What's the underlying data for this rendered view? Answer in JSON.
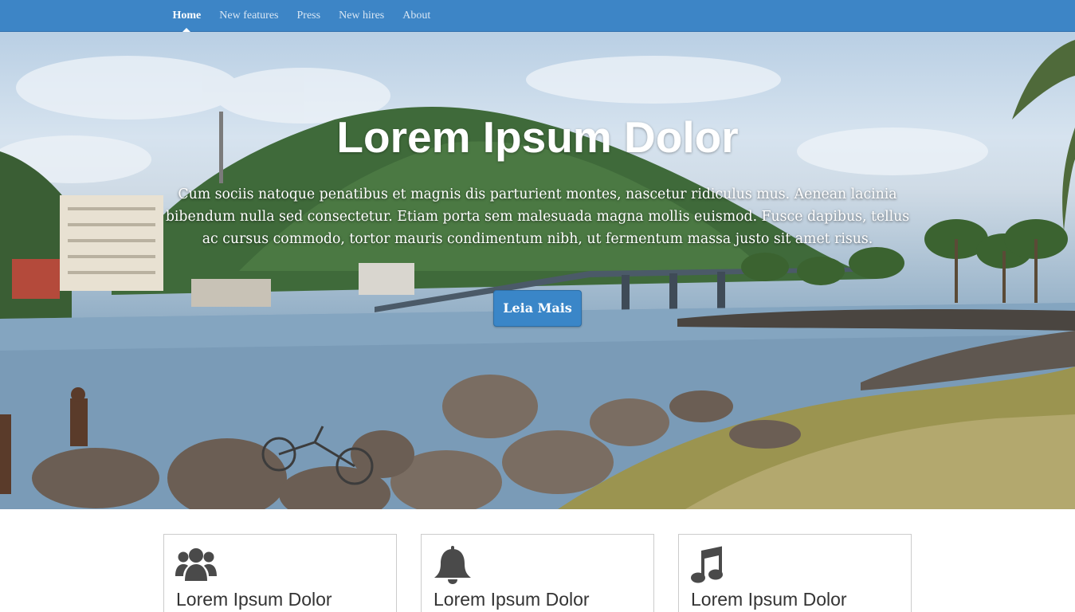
{
  "navbar": {
    "items": [
      {
        "label": "Home",
        "active": true
      },
      {
        "label": "New features",
        "active": false
      },
      {
        "label": "Press",
        "active": false
      },
      {
        "label": "New hires",
        "active": false
      },
      {
        "label": "About",
        "active": false
      }
    ],
    "background_color": "#3d85c6"
  },
  "hero": {
    "title": "Lorem Ipsum Dolor",
    "text": "Cum sociis natoque penatibus et magnis dis parturient montes, nascetur ridiculus mus. Aenean lacinia bibendum nulla sed consectetur. Etiam porta sem malesuada magna mollis euismod. Fusce dapibus, tellus ac cursus commodo, tortor mauris condimentum nibh, ut fermentum massa justo sit amet risus.",
    "button_label": "Leia Mais",
    "button_color": "#3a86c8",
    "background_image": "coastal bay with rocks, bridge and green hill"
  },
  "cards": [
    {
      "icon": "users-icon",
      "title": "Lorem Ipsum Dolor"
    },
    {
      "icon": "bell-icon",
      "title": "Lorem Ipsum Dolor"
    },
    {
      "icon": "music-icon",
      "title": "Lorem Ipsum Dolor"
    }
  ]
}
